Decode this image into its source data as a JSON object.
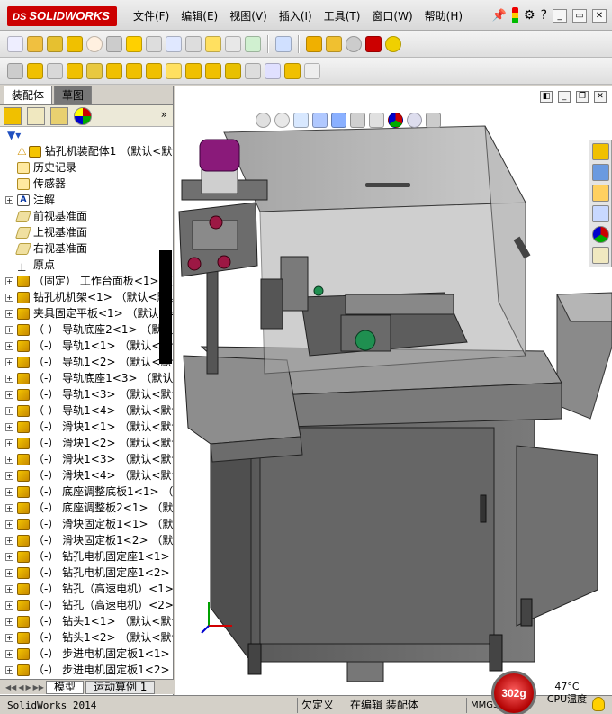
{
  "app": {
    "brand": "SOLIDWORKS",
    "brand_prefix": "DS",
    "menu": [
      "文件(F)",
      "编辑(E)",
      "视图(V)",
      "插入(I)",
      "工具(T)",
      "窗口(W)",
      "帮助(H)"
    ],
    "help_icon": "?"
  },
  "left_panel": {
    "tabs": [
      "装配体",
      "草图"
    ],
    "expand_chevron": "»",
    "tree": [
      {
        "label": "钻孔机装配体1 （默认<默认",
        "icon": "root",
        "warn": true,
        "exp": ""
      },
      {
        "label": "历史记录",
        "icon": "folder",
        "exp": ""
      },
      {
        "label": "传感器",
        "icon": "folder",
        "exp": ""
      },
      {
        "label": "注解",
        "icon": "note",
        "exp": "+"
      },
      {
        "label": "前视基准面",
        "icon": "plane",
        "exp": ""
      },
      {
        "label": "上视基准面",
        "icon": "plane",
        "exp": ""
      },
      {
        "label": "右视基准面",
        "icon": "plane",
        "exp": ""
      },
      {
        "label": "原点",
        "icon": "origin",
        "exp": ""
      },
      {
        "label": "（固定） 工作台面板<1> （默认<",
        "icon": "part",
        "exp": "+"
      },
      {
        "label": "钻孔机机架<1> （默认<默认",
        "icon": "part",
        "exp": "+"
      },
      {
        "label": "夹具固定平板<1> （默认<<默",
        "icon": "part",
        "exp": "+"
      },
      {
        "label": "（-） 导轨底座2<1> （默认<<",
        "icon": "part",
        "exp": "+"
      },
      {
        "label": "（-） 导轨1<1> （默认<默认>",
        "icon": "part",
        "exp": "+"
      },
      {
        "label": "（-） 导轨1<2> （默认<默认>",
        "icon": "part",
        "exp": "+"
      },
      {
        "label": "（-） 导轨底座1<3> （默认<<默",
        "icon": "part",
        "exp": "+"
      },
      {
        "label": "（-） 导轨1<3> （默认<默认>",
        "icon": "part",
        "exp": "+"
      },
      {
        "label": "（-） 导轨1<4> （默认<默认>",
        "icon": "part",
        "exp": "+"
      },
      {
        "label": "（-） 滑块1<1> （默认<默认>",
        "icon": "part",
        "exp": "+"
      },
      {
        "label": "（-） 滑块1<2> （默认<默认>",
        "icon": "part",
        "exp": "+"
      },
      {
        "label": "（-） 滑块1<3> （默认<默认>",
        "icon": "part",
        "exp": "+"
      },
      {
        "label": "（-） 滑块1<4> （默认<默认>",
        "icon": "part",
        "exp": "+"
      },
      {
        "label": "（-） 底座调整底板1<1> （默认",
        "icon": "part",
        "exp": "+"
      },
      {
        "label": "（-） 底座调整板2<1> （默认<",
        "icon": "part",
        "exp": "+"
      },
      {
        "label": "（-） 滑块固定板1<1> （默认<",
        "icon": "part",
        "exp": "+"
      },
      {
        "label": "（-） 滑块固定板1<2> （默认<",
        "icon": "part",
        "exp": "+"
      },
      {
        "label": "（-） 钻孔电机固定座1<1> （默",
        "icon": "part",
        "exp": "+"
      },
      {
        "label": "（-） 钻孔电机固定座1<2> （默",
        "icon": "part",
        "exp": "+"
      },
      {
        "label": "（-） 钻孔（高速电机）<1> （",
        "icon": "part",
        "exp": "+"
      },
      {
        "label": "（-） 钻孔（高速电机）<2> （",
        "icon": "part",
        "exp": "+"
      },
      {
        "label": "（-） 钻头1<1> （默认<默认>",
        "icon": "part",
        "exp": "+"
      },
      {
        "label": "（-） 钻头1<2> （默认<默认>",
        "icon": "part",
        "exp": "+"
      },
      {
        "label": "（-） 步进电机固定板1<1> （默",
        "icon": "part",
        "exp": "+"
      },
      {
        "label": "（-） 步进电机固定板1<2> （默",
        "icon": "part",
        "exp": "+"
      }
    ],
    "bottom_tabs": [
      "模型",
      "运动算例 1"
    ]
  },
  "status": {
    "app_version": "SolidWorks 2014",
    "state1": "欠定义",
    "state2": "在编辑 装配体",
    "units": "MMGS",
    "gauge": "302g",
    "temp": "47°C",
    "temp_label": "CPU温度"
  },
  "colors": {
    "frame_fill": "#6b6b6b",
    "cover_fill": "#b9b9b9",
    "motor_cap": "#8a1a7a",
    "button_red": "#9c1844",
    "accent_red": "#cc0000"
  }
}
